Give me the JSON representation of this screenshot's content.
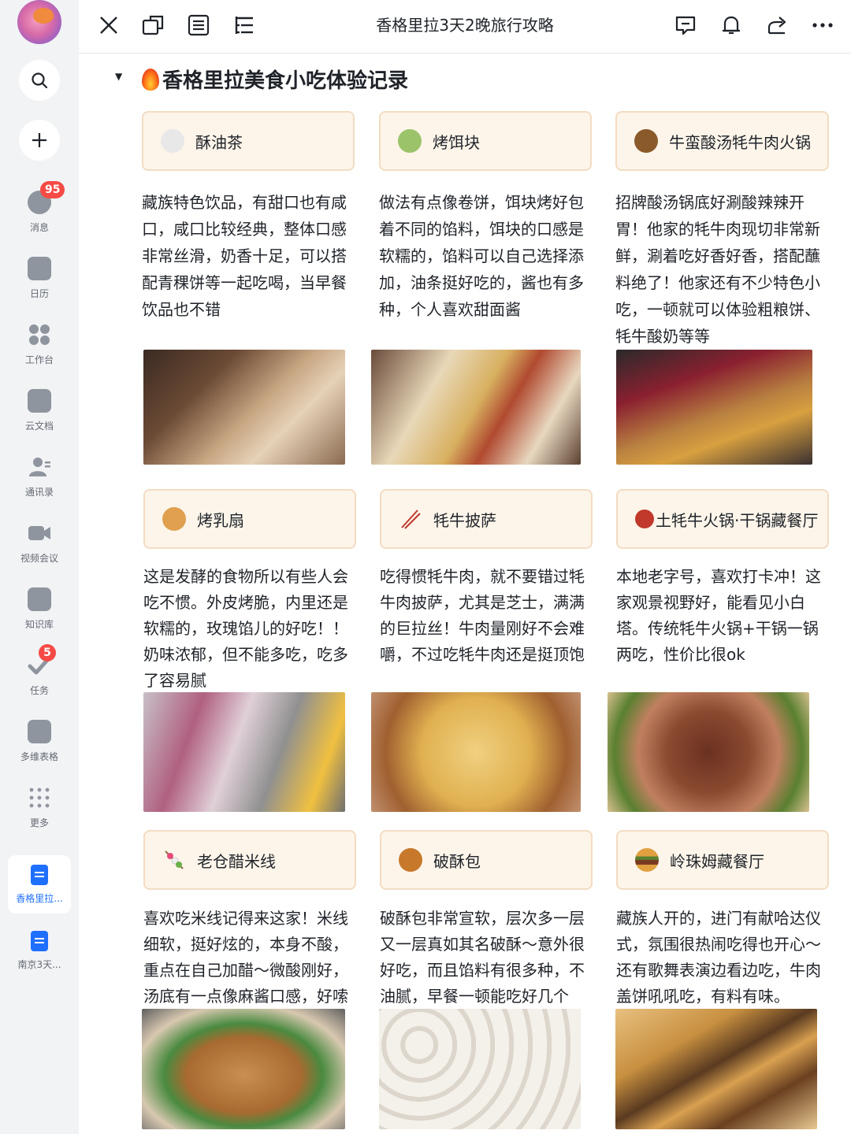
{
  "sidebar": {
    "items": [
      {
        "label": "消息",
        "badge": "95"
      },
      {
        "label": "日历"
      },
      {
        "label": "工作台"
      },
      {
        "label": "云文档"
      },
      {
        "label": "通讯录"
      },
      {
        "label": "视频会议"
      },
      {
        "label": "知识库"
      },
      {
        "label": "任务",
        "badge": "5"
      },
      {
        "label": "多维表格"
      },
      {
        "label": "更多"
      }
    ],
    "docs": [
      {
        "label": "香格里拉..."
      },
      {
        "label": "南京3天..."
      }
    ]
  },
  "topbar": {
    "title": "香格里拉3天2晚旅行攻略"
  },
  "section": {
    "heading": "香格里拉美食小吃体验记录"
  },
  "cards": [
    {
      "title": "酥油茶",
      "icon": "teapot-icon",
      "text": "藏族特色饮品，有甜口也有咸口，咸口比较经典，整体口感非常丝滑，奶香十足，可以搭配青稞饼等一起吃喝，当早餐饮品也不错"
    },
    {
      "title": "烤饵块",
      "icon": "bowl-icon",
      "text": "做法有点像卷饼，饵块烤好包着不同的馅料，饵块的口感是软糯的，馅料可以自己选择添加，油条挺好吃的，酱也有多种，个人喜欢甜面酱"
    },
    {
      "title": "牛蛮酸汤牦牛肉火锅",
      "icon": "ox-icon",
      "text": "招牌酸汤锅底好涮酸辣辣开胃！他家的牦牛肉现切非常新鲜，涮着吃好香好香，搭配蘸料绝了！他家还有不少特色小吃，一顿就可以体验粗粮饼、牦牛酸奶等等"
    },
    {
      "title": "烤乳扇",
      "icon": "croissant-icon",
      "text": "这是发酵的食物所以有些人会吃不惯。外皮烤脆，内里还是软糯的，玫瑰馅儿的好吃！！奶味浓郁，但不能多吃，吃多了容易腻"
    },
    {
      "title": "牦牛披萨",
      "icon": "chopsticks-icon",
      "text": "吃得惯牦牛肉，就不要错过牦牛肉披萨，尤其是芝士，满满的巨拉丝！牛肉量刚好不会难嚼，不过吃牦牛肉还是挺顶饱"
    },
    {
      "title": "土牦牛火锅·干锅藏餐厅",
      "icon": "meat-icon",
      "text": "本地老字号，喜欢打卡冲！这家观景视野好，能看见小白塔。传统牦牛火锅+干锅一锅两吃，性价比很ok"
    },
    {
      "title": "老仓醋米线",
      "icon": "skewer-icon",
      "text": "喜欢吃米线记得来这家！米线细软，挺好炫的，本身不酸，重点在自己加醋～微酸刚好，汤底有一点像麻酱口感，好嗦"
    },
    {
      "title": "破酥包",
      "icon": "mooncake-icon",
      "text": "破酥包非常宣软，层次多一层又一层真如其名破酥～意外很好吃，而且馅料有很多种，不油腻，早餐一顿能吃好几个"
    },
    {
      "title": "岭珠姆藏餐厅",
      "icon": "burger-icon",
      "text": "藏族人开的，进门有献哈达仪式，氛围很热闹吃得也开心～还有歌舞表演边看边吃，牛肉盖饼吼吼吃，有料有味。"
    }
  ]
}
